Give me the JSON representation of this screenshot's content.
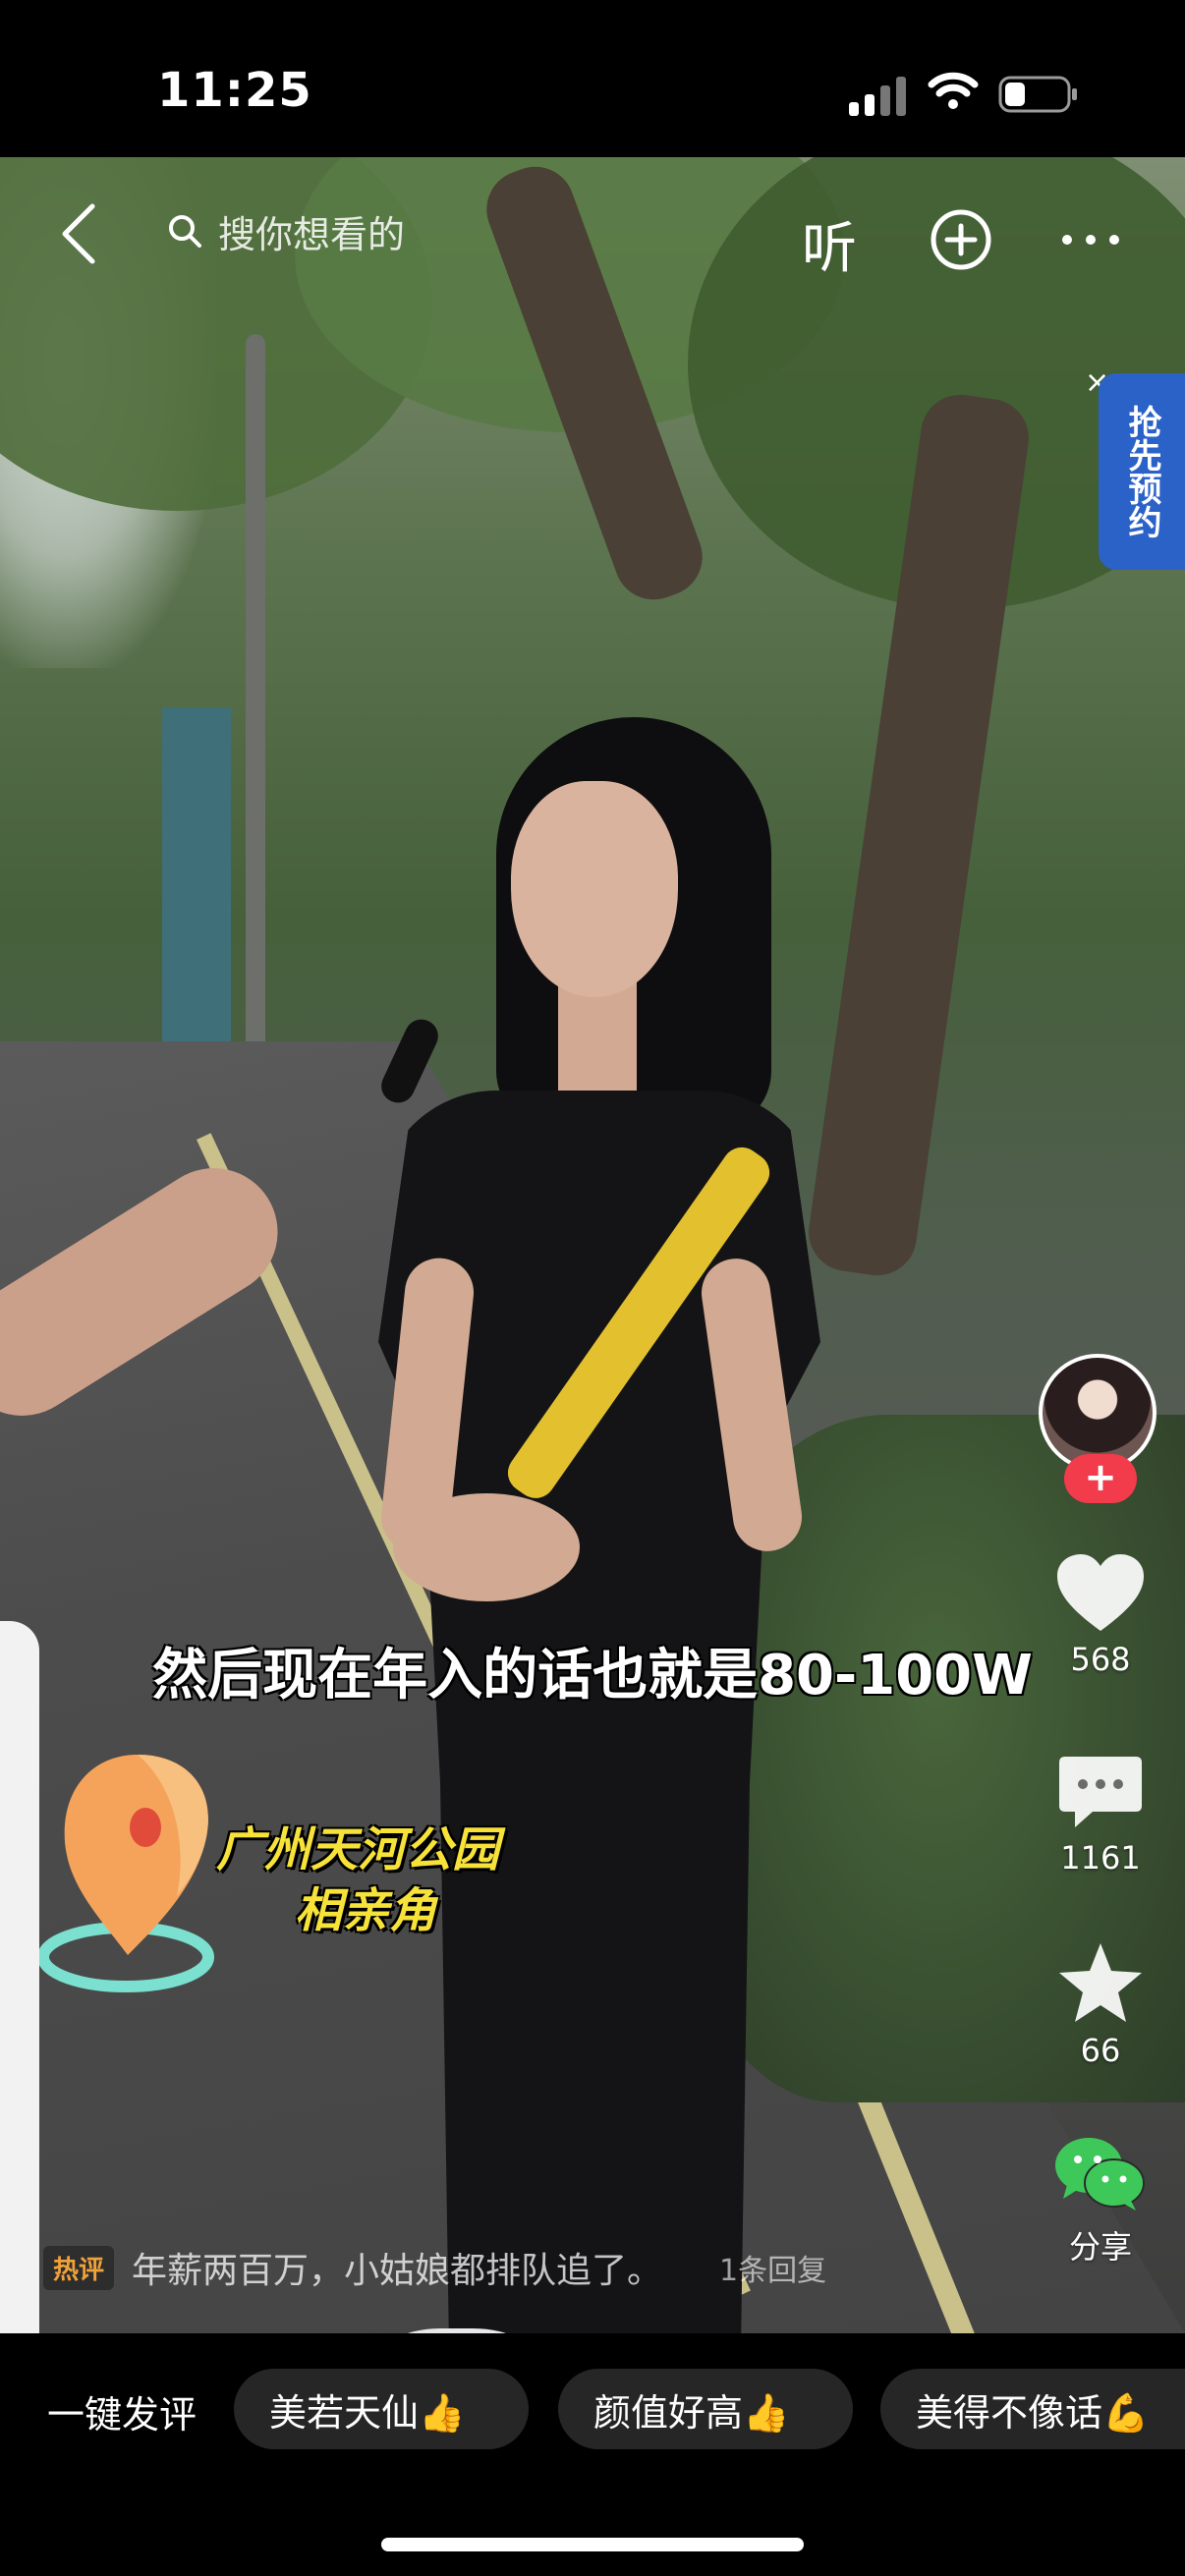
{
  "status_bar": {
    "time": "11:25",
    "battery_level": 0.3
  },
  "top_bar": {
    "search_placeholder": "搜你想看的",
    "listen_label": "听"
  },
  "promo": {
    "label": "抢先预约"
  },
  "video": {
    "subtitle": "然后现在年入的话也就是80-100W",
    "location_line1": "广州天河公园",
    "location_line2": "相亲角"
  },
  "actions": {
    "follow_symbol": "+",
    "likes": "568",
    "comments": "1161",
    "favorites": "66",
    "share_label": "分享"
  },
  "hot_comment": {
    "tag": "热评",
    "text": "年薪两百万，小姑娘都排队追了。",
    "reply_label": "1条回复"
  },
  "quick_comments": {
    "label": "一键发评",
    "chips": [
      "美若天仙👍",
      "颜值好高👍",
      "美得不像话💪"
    ]
  },
  "colors": {
    "follow_red": "#f23b4b",
    "promo_blue": "#2b62c8",
    "location_yellow": "#f7e23a",
    "share_green": "#3fc85a"
  }
}
